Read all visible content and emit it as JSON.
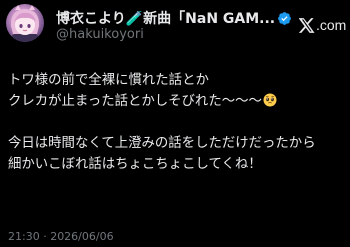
{
  "author": {
    "display_name": "博衣こより🧪新曲「NaN GAM...",
    "handle": "@hakuikoyori",
    "verified_icon": "verified-badge-icon"
  },
  "brand": {
    "logo_icon": "x-logo-icon",
    "text": ".com"
  },
  "tweet": {
    "lines": [
      "トワ様の前で全裸に慣れた話とか",
      "クレカが止まった話とかしそびれた〜〜〜",
      "今日は時間なくて上澄みの話をしただけだったから",
      "細かいこぼれ話はちょこちょこしてくね！"
    ],
    "emoji_icon": "pleading-face-emoji-icon"
  },
  "timestamp": "21:30 · 2026/06/06",
  "colors": {
    "background": "#000000",
    "text": "#e7e9ea",
    "secondary_text": "#71767b",
    "verified": "#1d9bf0"
  }
}
